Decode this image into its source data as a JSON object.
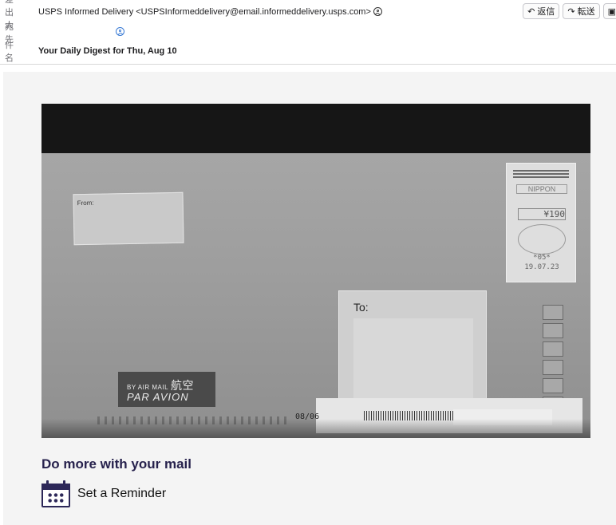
{
  "header": {
    "from_label": "差出人",
    "from_value": "USPS Informed Delivery <USPSInformeddelivery@email.informeddelivery.usps.com>",
    "to_label": "宛先",
    "to_value": "",
    "subject_label": "件名",
    "subject_value": "Your Daily Digest for Thu, Aug 10",
    "buttons": {
      "reply_label": "返信",
      "forward_label": "転送"
    },
    "icons": {
      "person": "person-circle-icon",
      "reply": "reply-arrow-icon",
      "forward": "forward-arrow-icon",
      "archive": "archive-box-icon"
    }
  },
  "mailpiece": {
    "from_label": "From:",
    "to_label": "To:",
    "stamp_text": "NIPPON",
    "stamp_value": "¥190",
    "postmark_number": "*05*",
    "postmark_date": "19.07.23",
    "airmail_line1": "BY AIR MAIL",
    "airmail_kanji": "航空",
    "airmail_line2": "PAR AVION",
    "scan_date": "08/06"
  },
  "promo": {
    "heading": "Do more with your mail",
    "reminder_label": "Set a Reminder",
    "reminder_icon": "calendar-icon",
    "accent_color": "#2c2758"
  }
}
